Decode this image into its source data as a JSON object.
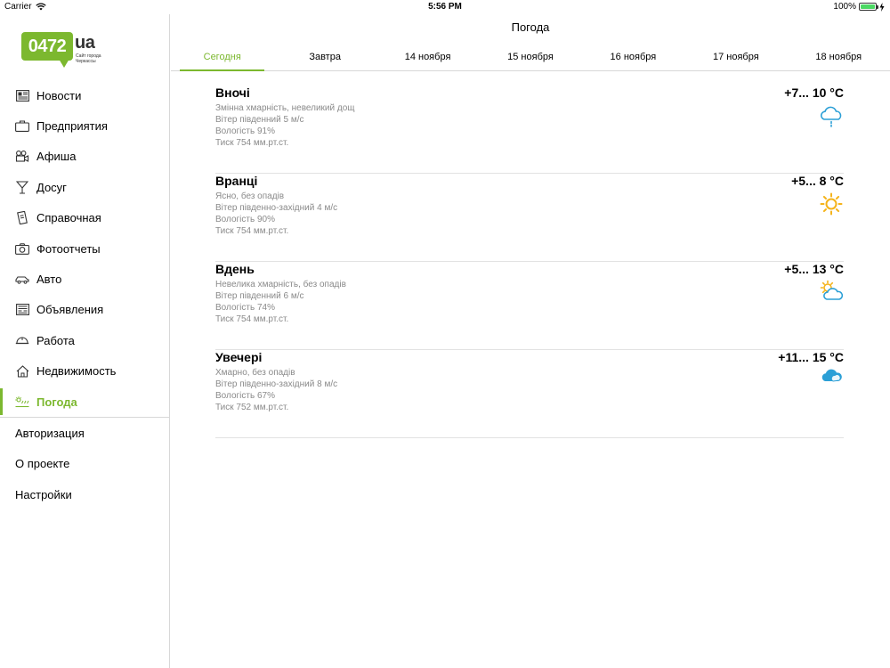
{
  "status_bar": {
    "carrier": "Carrier",
    "time": "5:56 PM",
    "battery": "100%",
    "battery_level": 1.0
  },
  "logo": {
    "number": "0472",
    "domain": "ua",
    "tagline": "Сайт города Черкассы"
  },
  "nav": {
    "items": [
      {
        "label": "Новости",
        "icon": "newspaper-icon"
      },
      {
        "label": "Предприятия",
        "icon": "briefcase-icon"
      },
      {
        "label": "Афиша",
        "icon": "movie-camera-icon"
      },
      {
        "label": "Досуг",
        "icon": "cocktail-icon"
      },
      {
        "label": "Справочная",
        "icon": "phone-book-icon"
      },
      {
        "label": "Фотоотчеты",
        "icon": "camera-icon"
      },
      {
        "label": "Авто",
        "icon": "car-icon"
      },
      {
        "label": "Объявления",
        "icon": "board-icon"
      },
      {
        "label": "Работа",
        "icon": "helmet-icon"
      },
      {
        "label": "Недвижимость",
        "icon": "house-icon"
      },
      {
        "label": "Погода",
        "icon": "weather-icon",
        "active": true
      }
    ],
    "secondary": [
      {
        "label": "Авторизация"
      },
      {
        "label": "О проекте"
      },
      {
        "label": "Настройки"
      }
    ]
  },
  "header": {
    "title": "Погода"
  },
  "tabs": [
    {
      "label": "Сегодня",
      "active": true
    },
    {
      "label": "Завтра"
    },
    {
      "label": "14 ноября"
    },
    {
      "label": "15 ноября"
    },
    {
      "label": "16 ноября"
    },
    {
      "label": "17 ноября"
    },
    {
      "label": "18 ноября"
    }
  ],
  "forecast": [
    {
      "period": "Вночі",
      "temp": "+7... 10 °C",
      "condition": "Змінна хмарність, невеликий дощ",
      "wind": "Вітер південний 5 м/с",
      "humidity": "Вологість 91%",
      "pressure": "Тиск 754 мм.рт.ст.",
      "icon": "rain-cloud-icon"
    },
    {
      "period": "Вранці",
      "temp": "+5... 8 °C",
      "condition": "Ясно, без опадів",
      "wind": "Вітер південно-західний 4 м/с",
      "humidity": "Вологість 90%",
      "pressure": "Тиск 754 мм.рт.ст.",
      "icon": "sun-icon"
    },
    {
      "period": "Вдень",
      "temp": "+5... 13 °C",
      "condition": "Невелика хмарність, без опадів",
      "wind": "Вітер південний 6 м/с",
      "humidity": "Вологість 74%",
      "pressure": "Тиск 754 мм.рт.ст.",
      "icon": "partly-cloudy-icon"
    },
    {
      "period": "Увечері",
      "temp": "+11... 15 °C",
      "condition": "Хмарно, без опадів",
      "wind": "Вітер південно-західний 8 м/с",
      "humidity": "Вологість 67%",
      "pressure": "Тиск 752 мм.рт.ст.",
      "icon": "cloud-icon"
    }
  ],
  "colors": {
    "accent": "#7cb82f",
    "weather_blue": "#2b9fd6",
    "sun_yellow": "#f5b31a",
    "secondary_text": "#8a8a8a"
  }
}
